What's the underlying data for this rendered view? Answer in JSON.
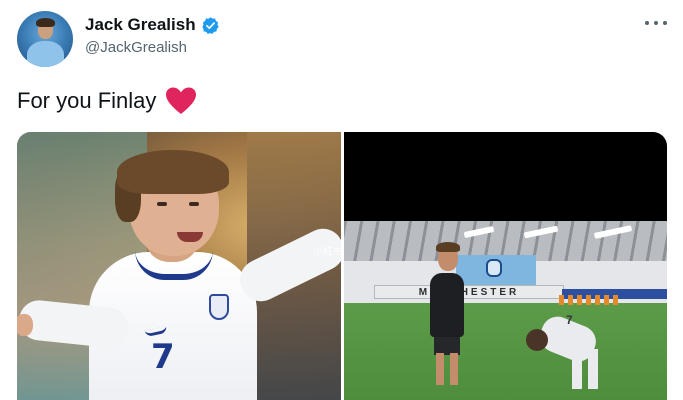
{
  "tweet": {
    "author": {
      "display_name": "Jack Grealish",
      "handle": "@JackGrealish",
      "verified": true
    },
    "text": "For you Finlay",
    "emoji": "heart-emoji",
    "more_icon": "more-horizontal-icon",
    "colors": {
      "verified_blue": "#1d9bf0",
      "heart_red": "#e0245e",
      "handle_gray": "#536471"
    },
    "media": {
      "left_photo": {
        "shirt_number": "7"
      },
      "right_photo": {
        "board_text": "MANCHESTER",
        "kid_shirt_number": "7"
      },
      "watermark": "小红书"
    }
  }
}
